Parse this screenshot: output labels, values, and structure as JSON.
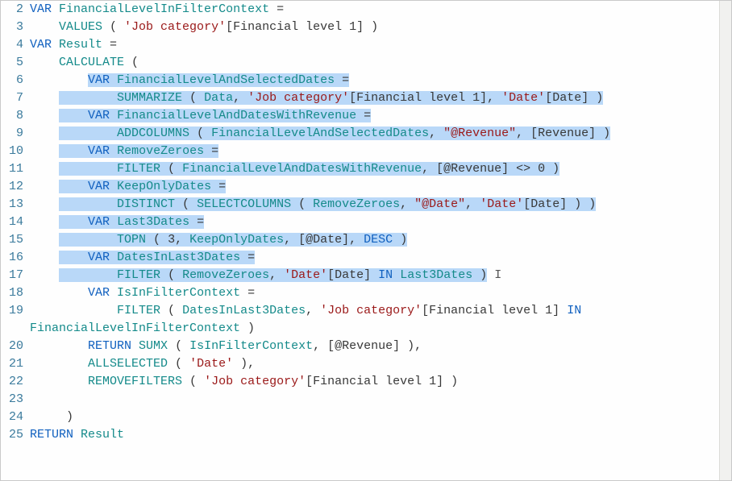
{
  "lines": {
    "l2_num": "2",
    "l3_num": "3",
    "l4_num": "4",
    "l5_num": "5",
    "l6_num": "6",
    "l7_num": "7",
    "l8_num": "8",
    "l9_num": "9",
    "l10_num": "10",
    "l11_num": "11",
    "l12_num": "12",
    "l13_num": "13",
    "l14_num": "14",
    "l15_num": "15",
    "l16_num": "16",
    "l17_num": "17",
    "l18_num": "18",
    "l19_num": "19",
    "l19b_num": "",
    "l20_num": "20",
    "l21_num": "21",
    "l22_num": "22",
    "l23_num": "23",
    "l24_num": "24",
    "l25_num": "25"
  },
  "tokens": {
    "VAR": "VAR",
    "RETURN": "RETURN",
    "IN": "IN",
    "DESC": "DESC",
    "FinancialLevelInFilterContext": "FinancialLevelInFilterContext",
    "Result": "Result",
    "FinancialLevelAndSelectedDates": "FinancialLevelAndSelectedDates",
    "FinancialLevelAndDatesWithRevenue": "FinancialLevelAndDatesWithRevenue",
    "RemoveZeroes": "RemoveZeroes",
    "KeepOnlyDates": "KeepOnlyDates",
    "Last3Dates": "Last3Dates",
    "DatesInLast3Dates": "DatesInLast3Dates",
    "IsInFilterContext": "IsInFilterContext",
    "VALUES": "VALUES",
    "CALCULATE": "CALCULATE",
    "SUMMARIZE": "SUMMARIZE",
    "ADDCOLUMNS": "ADDCOLUMNS",
    "FILTER": "FILTER",
    "DISTINCT": "DISTINCT",
    "SELECTCOLUMNS": "SELECTCOLUMNS",
    "TOPN": "TOPN",
    "SUMX": "SUMX",
    "ALLSELECTED": "ALLSELECTED",
    "REMOVEFILTERS": "REMOVEFILTERS",
    "Data": "Data",
    "JobCategory": "'Job category'",
    "Date": "'Date'",
    "FinancialLevel1": "[Financial level 1]",
    "DateCol": "[Date]",
    "Revenue": "[Revenue]",
    "atRevenue": "\"@Revenue\"",
    "atDate": "\"@Date\"",
    "atRevenueRef": "[@Revenue]",
    "atDateRef": "[@Date]",
    "eq": " =",
    "lp": " ( ",
    "lp_tight": " (",
    "rp": " )",
    "comma": ", ",
    "neq0": " <> 0",
    "three": "3",
    "comma_end": ","
  },
  "plain": {
    "indent4": "    ",
    "indent8": "        ",
    "indent12": "            ",
    "rp_comma": " ),"
  }
}
